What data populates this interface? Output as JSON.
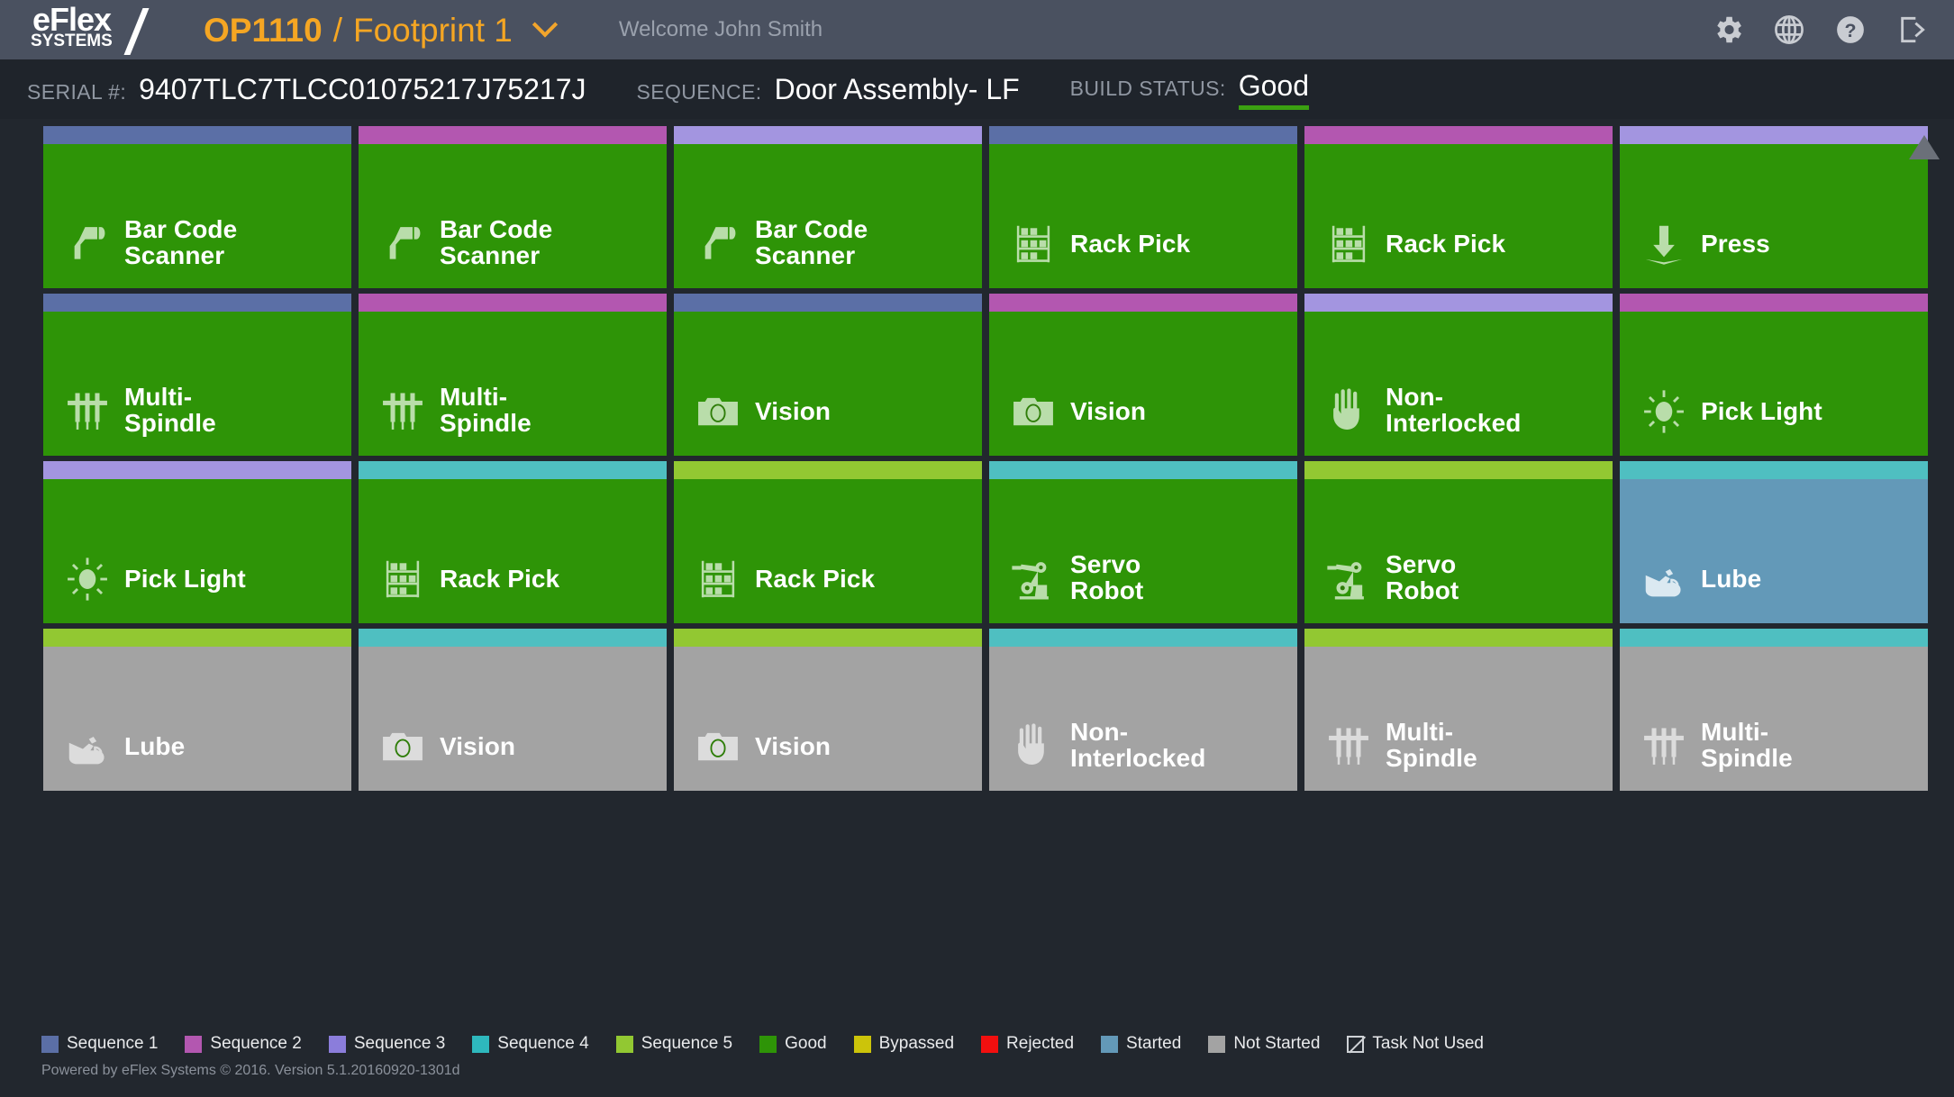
{
  "header": {
    "logo_top": "eFlex",
    "logo_bottom": "SYSTEMS",
    "station": "OP1110",
    "separator": "/",
    "footprint": "Footprint 1",
    "welcome": "Welcome John Smith",
    "icons": [
      "gear-icon",
      "globe-icon",
      "help-icon",
      "logout-icon"
    ]
  },
  "info": {
    "serial_label": "SERIAL #:",
    "serial_value": "9407TLC7TLCC01075217J75217J",
    "sequence_label": "SEQUENCE:",
    "sequence_value": "Door Assembly- LF",
    "build_status_label": "BUILD STATUS:",
    "build_status_value": "Good",
    "build_status_color": "#3ba011"
  },
  "colors": {
    "sequence1": "#5b6fa6",
    "sequence2": "#b357b0",
    "sequence3": "#a395e0",
    "sequence4": "#4fbfc1",
    "sequence5": "#92c832",
    "good": "#2e9407",
    "bypassed": "#ccc40a",
    "rejected": "#f20f0f",
    "started": "#6399b8",
    "not_started": "#a3a3a3"
  },
  "tiles": [
    {
      "label": "Bar Code\nScanner",
      "icon": "barcode-scanner-icon",
      "seq": "sequence1",
      "state": "good"
    },
    {
      "label": "Bar Code\nScanner",
      "icon": "barcode-scanner-icon",
      "seq": "sequence2",
      "state": "good"
    },
    {
      "label": "Bar Code\nScanner",
      "icon": "barcode-scanner-icon",
      "seq": "sequence3",
      "state": "good"
    },
    {
      "label": "Rack Pick",
      "icon": "rack-pick-icon",
      "seq": "sequence1",
      "state": "good"
    },
    {
      "label": "Rack Pick",
      "icon": "rack-pick-icon",
      "seq": "sequence2",
      "state": "good"
    },
    {
      "label": "Press",
      "icon": "press-icon",
      "seq": "sequence3",
      "state": "good"
    },
    {
      "label": "Multi-\nSpindle",
      "icon": "multi-spindle-icon",
      "seq": "sequence1",
      "state": "good"
    },
    {
      "label": "Multi-\nSpindle",
      "icon": "multi-spindle-icon",
      "seq": "sequence2",
      "state": "good"
    },
    {
      "label": "Vision",
      "icon": "vision-icon",
      "seq": "sequence1",
      "state": "good"
    },
    {
      "label": "Vision",
      "icon": "vision-icon",
      "seq": "sequence2",
      "state": "good"
    },
    {
      "label": "Non-\nInterlocked",
      "icon": "hand-icon",
      "seq": "sequence3",
      "state": "good"
    },
    {
      "label": "Pick Light",
      "icon": "pick-light-icon",
      "seq": "sequence2",
      "state": "good"
    },
    {
      "label": "Pick Light",
      "icon": "pick-light-icon",
      "seq": "sequence3",
      "state": "good"
    },
    {
      "label": "Rack Pick",
      "icon": "rack-pick-icon",
      "seq": "sequence4",
      "state": "good"
    },
    {
      "label": "Rack Pick",
      "icon": "rack-pick-icon",
      "seq": "sequence5",
      "state": "good"
    },
    {
      "label": "Servo\nRobot",
      "icon": "servo-robot-icon",
      "seq": "sequence4",
      "state": "good"
    },
    {
      "label": "Servo\nRobot",
      "icon": "servo-robot-icon",
      "seq": "sequence5",
      "state": "good"
    },
    {
      "label": "Lube",
      "icon": "lube-icon",
      "seq": "sequence4",
      "state": "started"
    },
    {
      "label": "Lube",
      "icon": "lube-icon",
      "seq": "sequence5",
      "state": "not_started"
    },
    {
      "label": "Vision",
      "icon": "vision-icon",
      "seq": "sequence4",
      "state": "not_started"
    },
    {
      "label": "Vision",
      "icon": "vision-icon",
      "seq": "sequence5",
      "state": "not_started"
    },
    {
      "label": "Non-\nInterlocked",
      "icon": "hand-icon",
      "seq": "sequence4",
      "state": "not_started"
    },
    {
      "label": "Multi-\nSpindle",
      "icon": "multi-spindle-icon",
      "seq": "sequence5",
      "state": "not_started"
    },
    {
      "label": "Multi-\nSpindle",
      "icon": "multi-spindle-icon",
      "seq": "sequence4",
      "state": "not_started"
    }
  ],
  "legend": [
    {
      "label": "Sequence 1",
      "color": "#5b6fa6",
      "shape": "swatch"
    },
    {
      "label": "Sequence 2",
      "color": "#b357b0",
      "shape": "swatch"
    },
    {
      "label": "Sequence 3",
      "color": "#8b7ddb",
      "shape": "swatch"
    },
    {
      "label": "Sequence 4",
      "color": "#2eb8bd",
      "shape": "swatch"
    },
    {
      "label": "Sequence 5",
      "color": "#92c832",
      "shape": "swatch"
    },
    {
      "label": "Good",
      "color": "#2e9407",
      "shape": "swatch"
    },
    {
      "label": "Bypassed",
      "color": "#ccc40a",
      "shape": "swatch"
    },
    {
      "label": "Rejected",
      "color": "#f20f0f",
      "shape": "swatch"
    },
    {
      "label": "Started",
      "color": "#6399b8",
      "shape": "swatch"
    },
    {
      "label": "Not Started",
      "color": "#a3a3a3",
      "shape": "swatch"
    },
    {
      "label": "Task Not Used",
      "color": "#cfd2d6",
      "shape": "slash"
    }
  ],
  "footer": {
    "text": "Powered by eFlex Systems © 2016. Version 5.1.20160920-1301d"
  }
}
